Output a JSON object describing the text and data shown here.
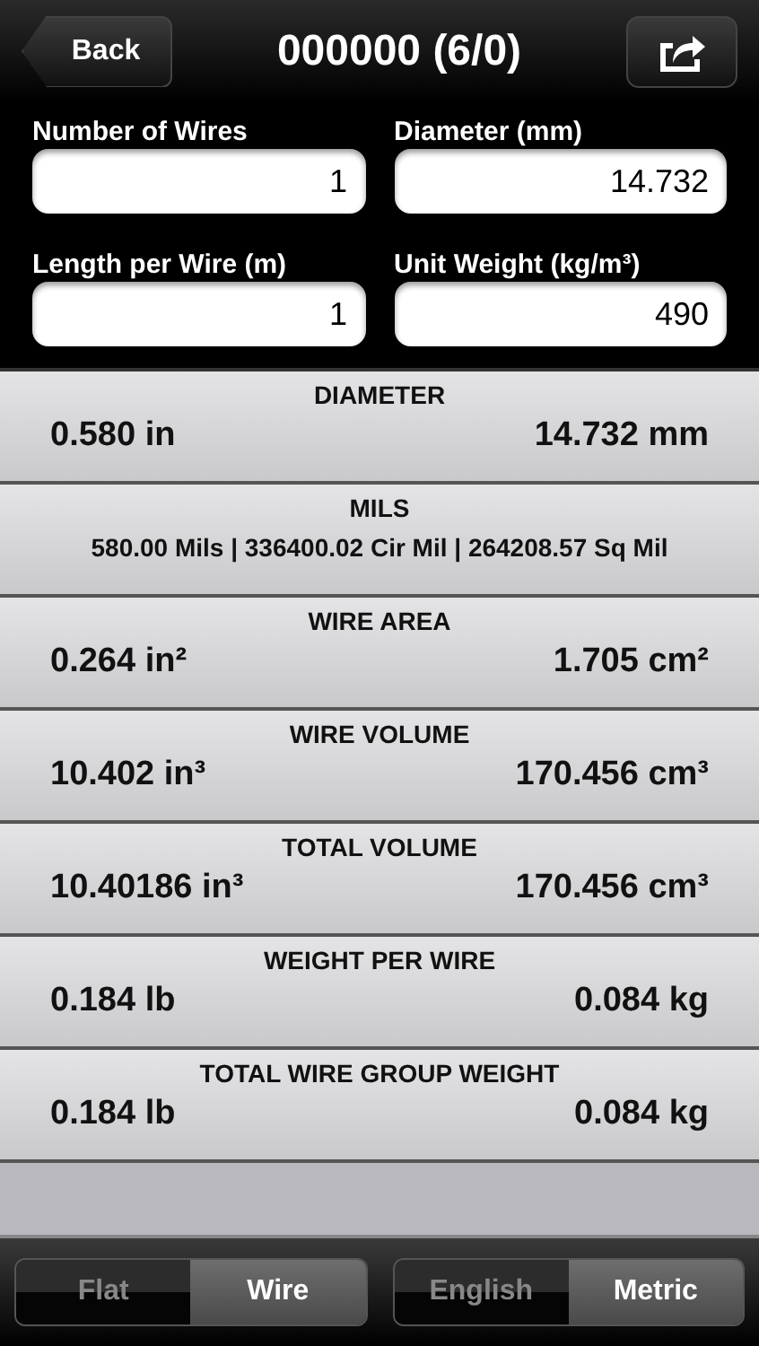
{
  "nav": {
    "back": "Back",
    "title": "000000 (6/0)"
  },
  "inputs": [
    {
      "label": "Number of Wires",
      "value": "1"
    },
    {
      "label": "Diameter (mm)",
      "value": "14.732"
    },
    {
      "label": "Length per Wire (m)",
      "value": "1"
    },
    {
      "label": "Unit Weight (kg/m³)",
      "value": "490"
    }
  ],
  "results": [
    {
      "kind": "pair",
      "title": "DIAMETER",
      "left": "0.580 in",
      "right": "14.732 mm"
    },
    {
      "kind": "line",
      "title": "MILS",
      "text": "580.00 Mils | 336400.02 Cir Mil | 264208.57 Sq Mil"
    },
    {
      "kind": "pair",
      "title": "WIRE AREA",
      "left": "0.264 in²",
      "right": "1.705 cm²"
    },
    {
      "kind": "pair",
      "title": "WIRE VOLUME",
      "left": "10.402 in³",
      "right": "170.456 cm³"
    },
    {
      "kind": "pair",
      "title": "TOTAL VOLUME",
      "left": "10.40186 in³",
      "right": "170.456 cm³"
    },
    {
      "kind": "pair",
      "title": "WEIGHT PER WIRE",
      "left": "0.184 lb",
      "right": "0.084 kg"
    },
    {
      "kind": "pair",
      "title": "TOTAL WIRE GROUP WEIGHT",
      "left": "0.184 lb",
      "right": "0.084 kg"
    }
  ],
  "segments": [
    [
      {
        "label": "Flat",
        "selected": false
      },
      {
        "label": "Wire",
        "selected": true
      }
    ],
    [
      {
        "label": "English",
        "selected": false
      },
      {
        "label": "Metric",
        "selected": true
      }
    ]
  ]
}
